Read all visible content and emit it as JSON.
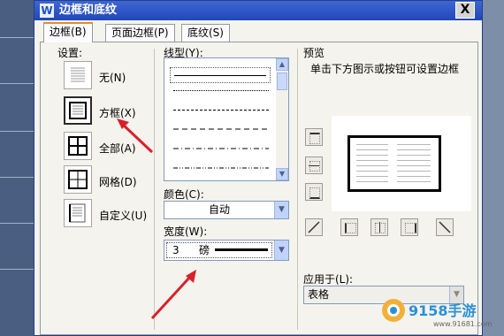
{
  "dialog": {
    "title": "边框和底纹",
    "title_icon": "W",
    "close_label": "X"
  },
  "tabs": [
    {
      "label": "边框(B)",
      "active": true
    },
    {
      "label": "页面边框(P)",
      "active": false
    },
    {
      "label": "底纹(S)",
      "active": false
    }
  ],
  "settings": {
    "heading": "设置:",
    "items": [
      {
        "label": "无(N)"
      },
      {
        "label": "方框(X)"
      },
      {
        "label": "全部(A)"
      },
      {
        "label": "网格(D)"
      },
      {
        "label": "自定义(U)"
      }
    ]
  },
  "line_style": {
    "heading": "线型(Y):"
  },
  "color": {
    "heading": "颜色(C):",
    "value": "自动"
  },
  "width": {
    "heading": "宽度(W):",
    "value": "3",
    "unit": "磅"
  },
  "preview": {
    "heading": "预览",
    "hint": "单击下方图示或按钮可设置边框"
  },
  "apply_to": {
    "heading": "应用于(L):",
    "value": "表格"
  },
  "watermark": {
    "brand": "9158手游",
    "url": "www.91681.com"
  },
  "colors": {
    "title_bar": "#2048b8",
    "annotation_arrow": "#d9202a"
  }
}
